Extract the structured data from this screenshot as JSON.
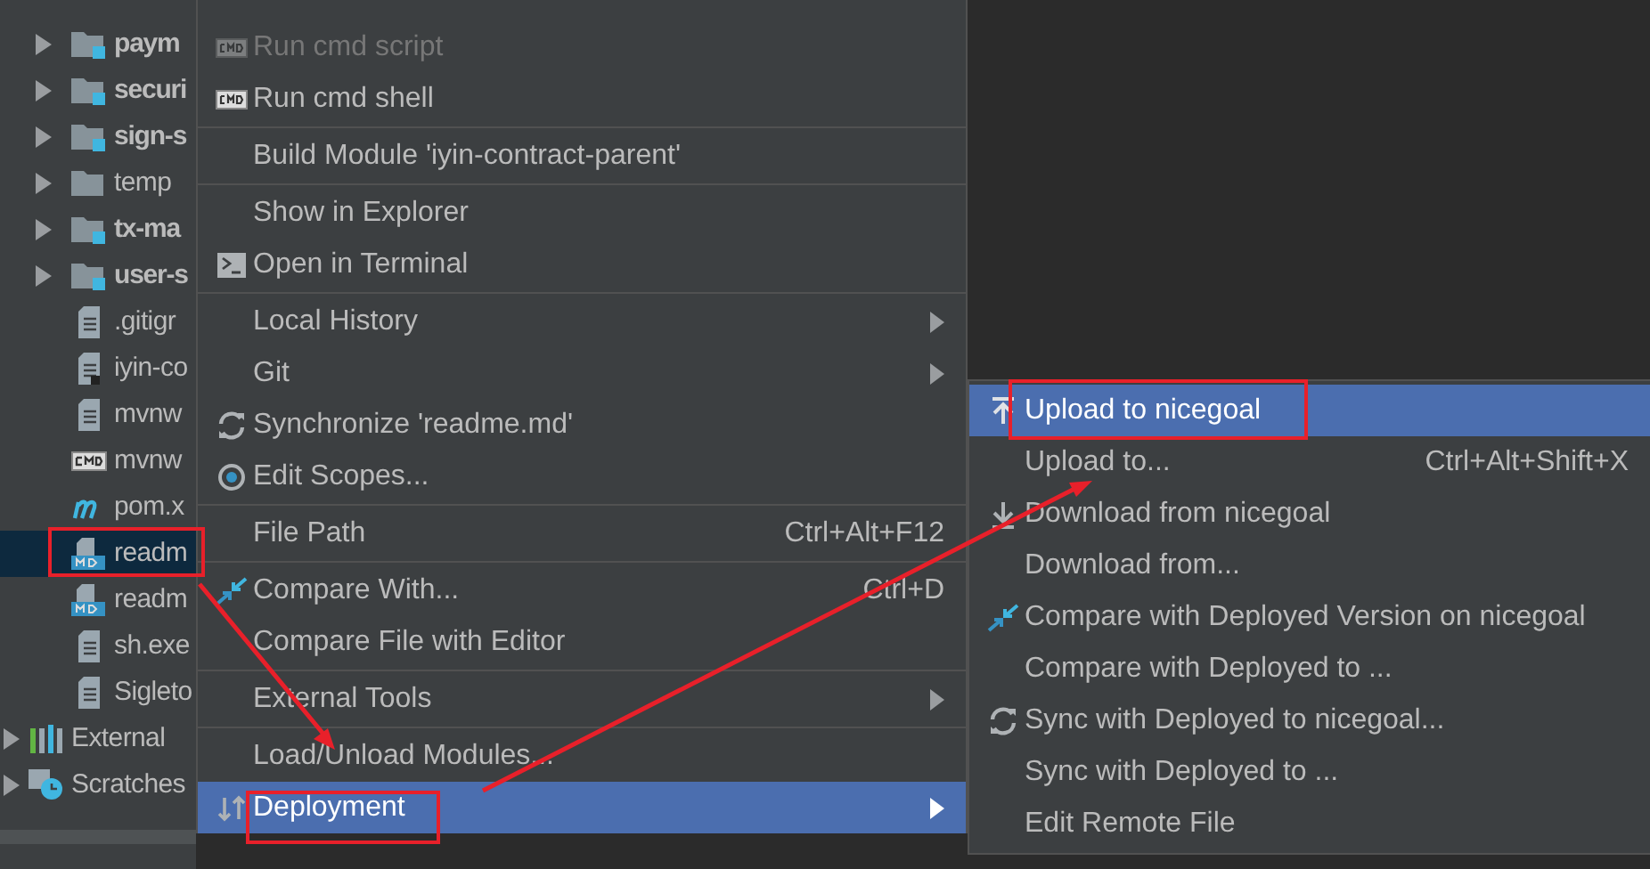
{
  "tree": {
    "module_children": [
      {
        "label": "paym",
        "kind": "module",
        "expanded": false,
        "selected": false
      },
      {
        "label": "securi",
        "kind": "module",
        "expanded": false,
        "selected": false
      },
      {
        "label": "sign-s",
        "kind": "module",
        "expanded": false,
        "selected": false
      },
      {
        "label": "temp",
        "kind": "folder",
        "expanded": false,
        "selected": false
      },
      {
        "label": "tx-ma",
        "kind": "module",
        "expanded": false,
        "selected": false
      },
      {
        "label": "user-s",
        "kind": "module",
        "expanded": false,
        "selected": false
      },
      {
        "label": ".gitigr",
        "kind": "text",
        "selected": false
      },
      {
        "label": "iyin-co",
        "kind": "shortcut",
        "selected": false
      },
      {
        "label": "mvnw",
        "kind": "text",
        "selected": false
      },
      {
        "label": "mvnw",
        "kind": "cmd",
        "selected": false
      },
      {
        "label": "pom.x",
        "kind": "maven",
        "selected": false
      },
      {
        "label": "readm",
        "kind": "markdown",
        "selected": true
      },
      {
        "label": "readm",
        "kind": "markdown",
        "selected": false
      },
      {
        "label": "sh.exe",
        "kind": "text",
        "selected": false
      },
      {
        "label": "Sigleto",
        "kind": "text",
        "selected": false
      }
    ],
    "root_items": [
      {
        "label": "External",
        "kind": "libraries",
        "expanded": false,
        "selected": false
      },
      {
        "label": "Scratches",
        "kind": "scratches",
        "expanded": false,
        "selected": false
      }
    ]
  },
  "context_menu": [
    {
      "kind": "item",
      "label": "Run cmd script",
      "disabled": true,
      "selected": false
    },
    {
      "kind": "item",
      "label": "Run cmd shell",
      "disabled": false,
      "selected": false
    },
    {
      "kind": "separator"
    },
    {
      "kind": "item",
      "label": "Build Module 'iyin-contract-parent'",
      "disabled": false,
      "selected": false
    },
    {
      "kind": "separator"
    },
    {
      "kind": "item",
      "label": "Show in Explorer",
      "disabled": false,
      "selected": false
    },
    {
      "kind": "item",
      "label": "Open in Terminal",
      "disabled": false,
      "selected": false
    },
    {
      "kind": "separator"
    },
    {
      "kind": "item",
      "label": "Local History",
      "submenu": true,
      "disabled": false,
      "selected": false
    },
    {
      "kind": "item",
      "label": "Git",
      "submenu": true,
      "disabled": false,
      "selected": false
    },
    {
      "kind": "item",
      "label": "Synchronize 'readme.md'",
      "disabled": false,
      "selected": false
    },
    {
      "kind": "item",
      "label": "Edit Scopes...",
      "disabled": false,
      "selected": false
    },
    {
      "kind": "separator"
    },
    {
      "kind": "item",
      "label": "File Path",
      "shortcut": "Ctrl+Alt+F12",
      "disabled": false,
      "selected": false
    },
    {
      "kind": "separator"
    },
    {
      "kind": "item",
      "label": "Compare With...",
      "shortcut": "Ctrl+D",
      "disabled": false,
      "selected": false
    },
    {
      "kind": "item",
      "label": "Compare File with Editor",
      "disabled": false,
      "selected": false
    },
    {
      "kind": "separator"
    },
    {
      "kind": "item",
      "label": "External Tools",
      "submenu": true,
      "disabled": false,
      "selected": false
    },
    {
      "kind": "separator"
    },
    {
      "kind": "item",
      "label": "Load/Unload Modules...",
      "disabled": false,
      "selected": false
    },
    {
      "kind": "item",
      "label": "Deployment",
      "submenu": true,
      "disabled": false,
      "selected": true
    }
  ],
  "deployment_submenu": [
    {
      "label": "Upload to nicegoal",
      "selected": true
    },
    {
      "label": "Upload to...",
      "shortcut": "Ctrl+Alt+Shift+X",
      "selected": false
    },
    {
      "label": "Download from nicegoal",
      "selected": false
    },
    {
      "label": "Download from...",
      "selected": false
    },
    {
      "label": "Compare with Deployed Version on nicegoal",
      "selected": false
    },
    {
      "label": "Compare with Deployed to ...",
      "selected": false
    },
    {
      "label": "Sync with Deployed to nicegoal...",
      "selected": false
    },
    {
      "label": "Sync with Deployed to ...",
      "selected": false
    },
    {
      "label": "Edit Remote File",
      "selected": false
    }
  ]
}
